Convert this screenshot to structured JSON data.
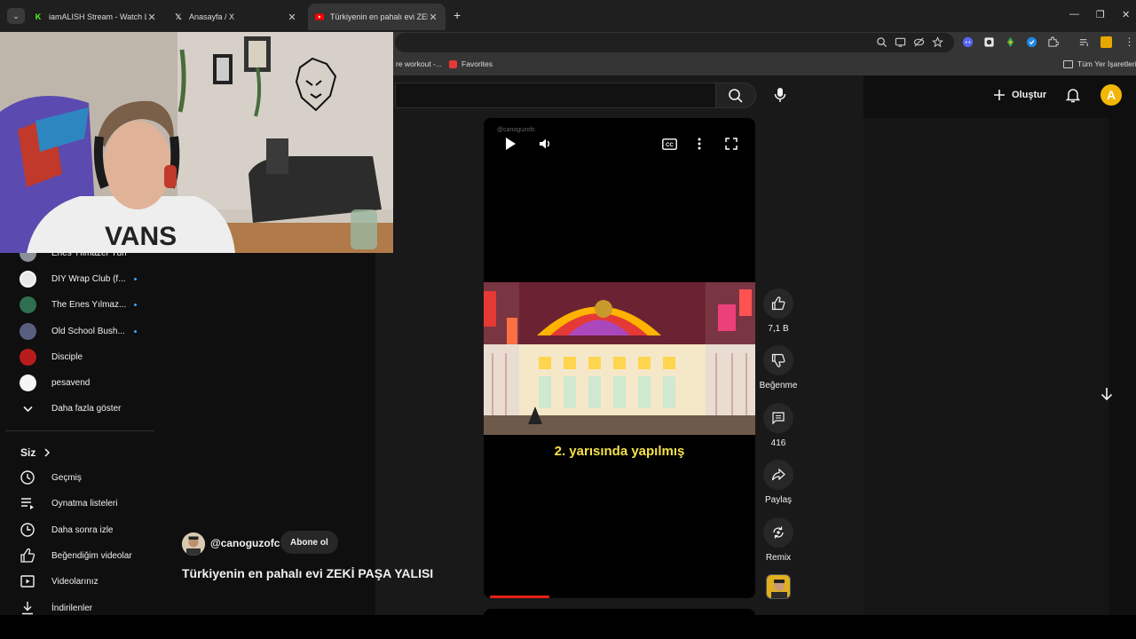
{
  "browser": {
    "tabs": [
      {
        "title": "iamALISH Stream - Watch Live o",
        "icon": "kick-icon",
        "color": "#53fc18"
      },
      {
        "title": "Anasayfa / X",
        "icon": "x-icon",
        "color": "#ffffff"
      },
      {
        "title": "Türkiyenin en pahalı evi ZEKİ PA",
        "icon": "youtube-icon",
        "color": "#ff0000"
      }
    ],
    "bookmarks": [
      {
        "label": "re workout -..."
      },
      {
        "label": "Favorites"
      }
    ],
    "all_bookmarks_label": "Tüm Yer İşaretleri"
  },
  "masthead": {
    "create_label": "Oluştur",
    "account_initial": "A",
    "account_color": "#f2b705"
  },
  "sidebar": {
    "subscriptions": [
      {
        "name": "Enes Yılmazer Türki...",
        "color": "#8a8f99",
        "dot": false
      },
      {
        "name": "DIY Wrap Club (f...",
        "color": "#e8e8e8",
        "dot": true
      },
      {
        "name": "The Enes Yılmaz...",
        "color": "#2f6f4f",
        "dot": true
      },
      {
        "name": "Old School Bush...",
        "color": "#5a5f80",
        "dot": true
      },
      {
        "name": "Disciple",
        "color": "#b71c1c",
        "dot": false
      },
      {
        "name": "pesavend",
        "color": "#f5f5f5",
        "dot": false
      }
    ],
    "show_more_label": "Daha fazla göster",
    "you_label": "Siz",
    "you_items": [
      {
        "label": "Geçmiş",
        "icon": "history-icon"
      },
      {
        "label": "Oynatma listeleri",
        "icon": "playlists-icon"
      },
      {
        "label": "Daha sonra izle",
        "icon": "watch-later-icon"
      },
      {
        "label": "Beğendiğim videolar",
        "icon": "liked-icon"
      },
      {
        "label": "Videolarınız",
        "icon": "your-videos-icon"
      },
      {
        "label": "İndirilenler",
        "icon": "downloads-icon"
      }
    ]
  },
  "short": {
    "watermark": "@canoguzofc",
    "caption": "2. yarısında yapılmış",
    "progress": 0.23,
    "channel_handle": "@canoguzofc",
    "subscribe_label": "Abone ol",
    "title": "Türkiyenin en pahalı evi ZEKİ PAŞA YALISI",
    "actions": {
      "like_count": "7,1 B",
      "dislike_label": "Beğenme",
      "comment_count": "416",
      "share_label": "Paylaş",
      "remix_label": "Remix"
    }
  }
}
